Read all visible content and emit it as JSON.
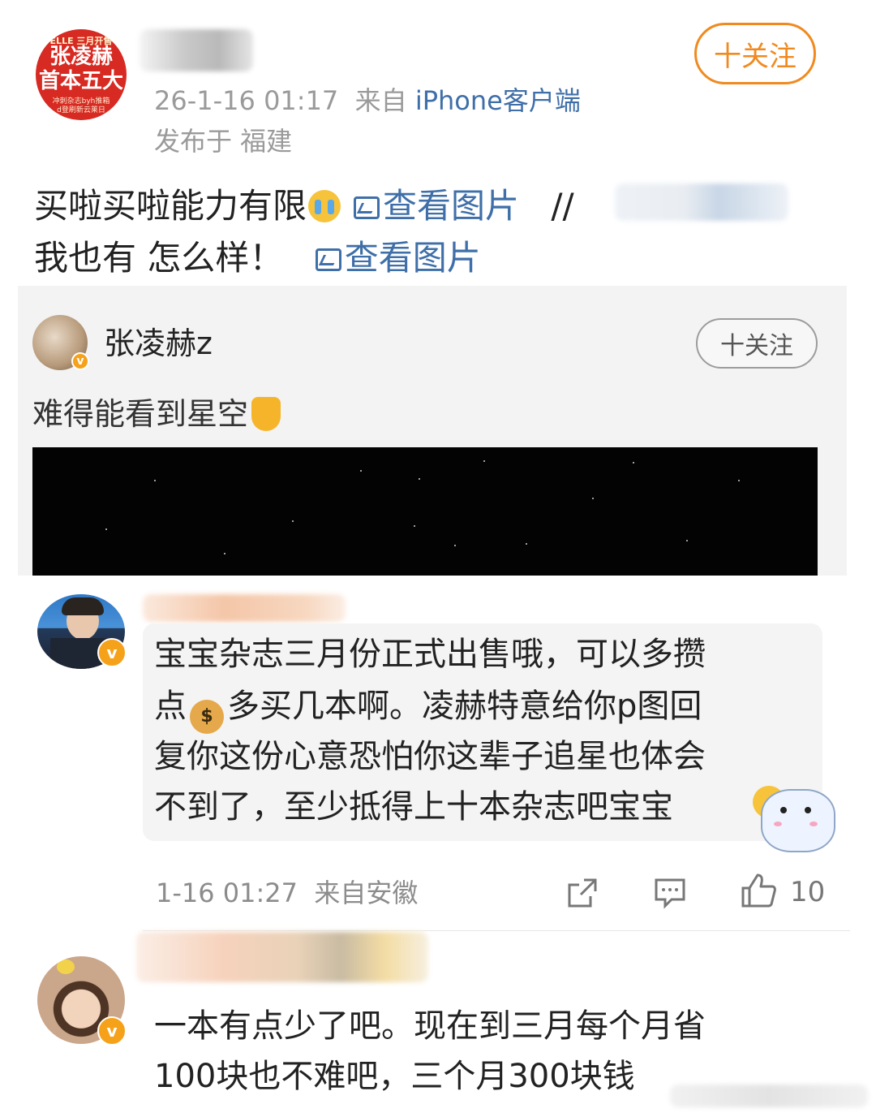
{
  "header": {
    "avatar_text": {
      "brand": "ELLE 三月开售",
      "line1": "张凌赫",
      "line2": "首本五大",
      "small": "冲刺杂志byh推箱\nd登刷新云莱日"
    },
    "follow_label": "十关注",
    "time": "26-1-16 01:17",
    "from_label": "来自",
    "source": "iPhone客户端",
    "location": "发布于 福建"
  },
  "post": {
    "line1_text": "买啦买啦能力有限",
    "line1_emoji": "crying-face",
    "view_image_label": "查看图片",
    "repost_sep": "//",
    "line2_text": "我也有 怎么样！",
    "view_image_label2": "查看图片"
  },
  "repost": {
    "author": "张凌赫z",
    "follow_label": "十关注",
    "text": "难得能看到星空",
    "text_emoji": "pointing-down-hand"
  },
  "comments": [
    {
      "lines": [
        "宝宝杂志三月份正式出售哦，可以多攒",
        "点",
        "多买几本啊。凌赫特意给你p图回",
        "复你这份心意恐怕你这辈子追星也体会",
        "不到了，至少抵得上十本杂志吧宝宝"
      ],
      "emojis": [
        "money-bag",
        "pleading-face",
        "cartoon-sticker"
      ],
      "time": "1-16 01:27",
      "location": "来自安徽",
      "actions": [
        "share-icon",
        "comment-icon",
        "like-icon"
      ],
      "likes": "10"
    },
    {
      "lines": [
        "一本有点少了吧。现在到三月每个月省",
        "100块也不难吧，三个月300块钱"
      ]
    }
  ],
  "colors": {
    "link": "#3f6fa8",
    "follow_orange": "#f08a20",
    "verified_badge": "#f6a11a",
    "meta_gray": "#9a9a9a"
  }
}
